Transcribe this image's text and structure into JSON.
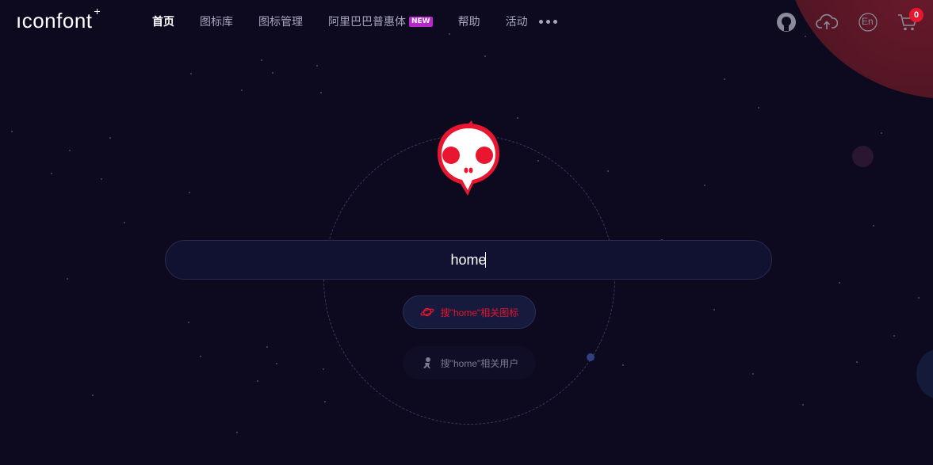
{
  "header": {
    "logo": "ıconfont",
    "logo_mark": "+",
    "nav": [
      {
        "label": "首页",
        "active": true
      },
      {
        "label": "图标库",
        "active": false
      },
      {
        "label": "图标管理",
        "active": false
      },
      {
        "label": "阿里巴巴普惠体",
        "active": false,
        "badge": "NEW"
      },
      {
        "label": "帮助",
        "active": false
      },
      {
        "label": "活动",
        "active": false
      }
    ],
    "tools": {
      "language": "En",
      "cart_count": "0"
    }
  },
  "search": {
    "value": "home"
  },
  "suggestions": {
    "icons": "搜\"home\"相关图标",
    "users": "搜\"home\"相关用户"
  },
  "colors": {
    "background": "#0d0a1f",
    "accent_red": "#e8162f",
    "badge_purple": "#b727c9"
  },
  "icons": [
    "github-icon",
    "upload-cloud-icon",
    "language-icon",
    "cart-icon",
    "planet-icon",
    "astronaut-icon",
    "skull-mascot"
  ]
}
